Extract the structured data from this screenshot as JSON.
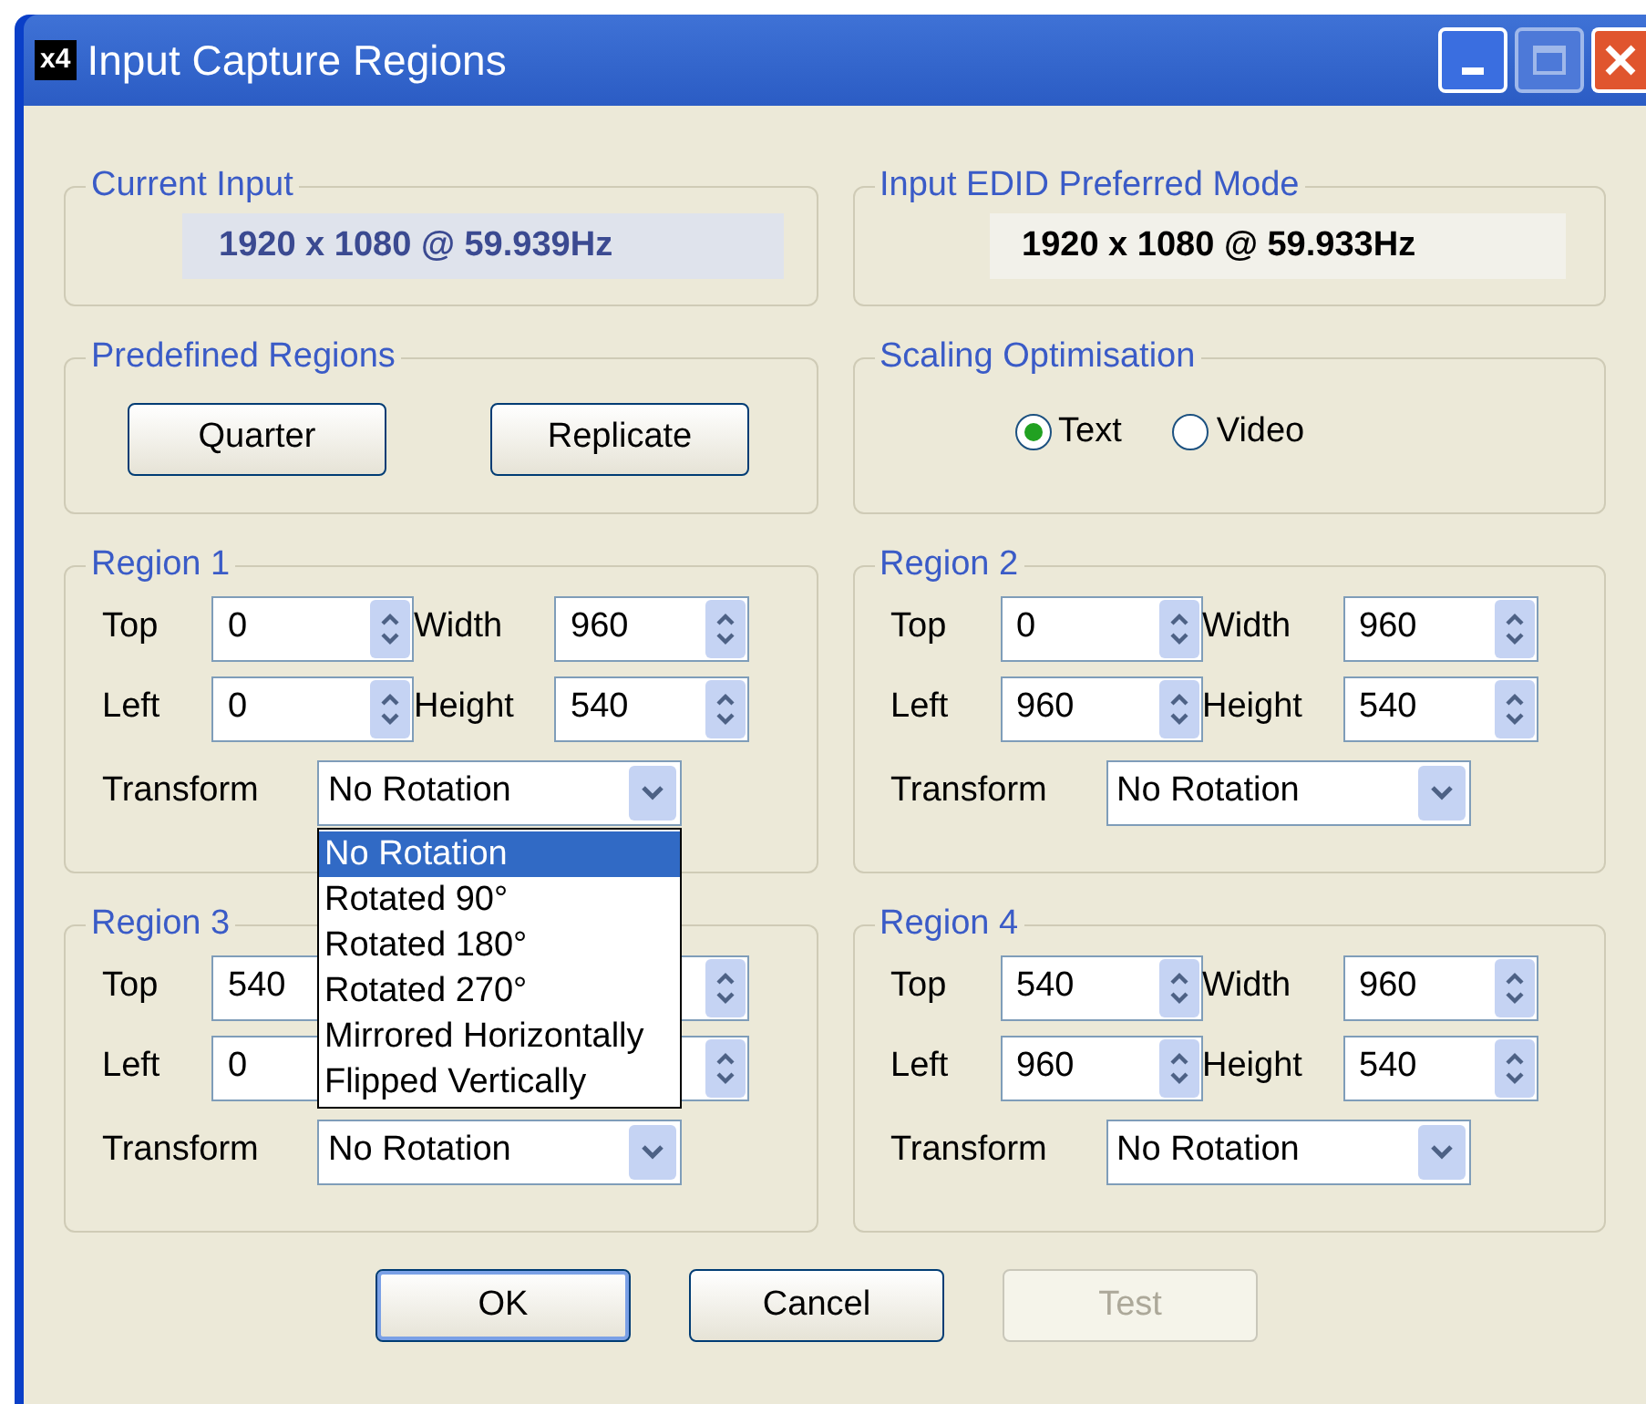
{
  "window": {
    "title": "Input Capture Regions",
    "logo": "x4"
  },
  "current_input": {
    "title": "Current Input",
    "value": "1920 x 1080 @ 59.939Hz"
  },
  "edid": {
    "title": "Input EDID Preferred Mode",
    "value": "1920 x 1080 @ 59.933Hz"
  },
  "predefined": {
    "title": "Predefined Regions",
    "buttons": [
      "Quarter",
      "Replicate"
    ]
  },
  "scaling": {
    "title": "Scaling Optimisation",
    "options": [
      {
        "label": "Text",
        "selected": true
      },
      {
        "label": "Video",
        "selected": false
      }
    ]
  },
  "regions": [
    {
      "title": "Region 1",
      "fields": {
        "top": {
          "label": "Top",
          "value": "0"
        },
        "width": {
          "label": "Width",
          "value": "960"
        },
        "left": {
          "label": "Left",
          "value": "0"
        },
        "height": {
          "label": "Height",
          "value": "540"
        }
      },
      "transform_label": "Transform",
      "transform": "No Rotation",
      "dropdown": {
        "options": [
          {
            "label": "No Rotation",
            "selected": true
          },
          {
            "label": "Rotated 90°",
            "selected": false
          },
          {
            "label": "Rotated 180°",
            "selected": false
          },
          {
            "label": "Rotated 270°",
            "selected": false
          },
          {
            "label": "Mirrored Horizontally",
            "selected": false
          },
          {
            "label": "Flipped Vertically",
            "selected": false
          }
        ]
      }
    },
    {
      "title": "Region 2",
      "fields": {
        "top": {
          "label": "Top",
          "value": "0"
        },
        "width": {
          "label": "Width",
          "value": "960"
        },
        "left": {
          "label": "Left",
          "value": "960"
        },
        "height": {
          "label": "Height",
          "value": "540"
        }
      },
      "transform_label": "Transform",
      "transform": "No Rotation"
    },
    {
      "title": "Region 3",
      "fields": {
        "top": {
          "label": "Top",
          "value": "540"
        },
        "left": {
          "label": "Left",
          "value": "0"
        }
      },
      "transform_label": "Transform",
      "transform": "No Rotation"
    },
    {
      "title": "Region 4",
      "fields": {
        "top": {
          "label": "Top",
          "value": "540"
        },
        "width": {
          "label": "Width",
          "value": "960"
        },
        "left": {
          "label": "Left",
          "value": "960"
        },
        "height": {
          "label": "Height",
          "value": "540"
        }
      },
      "transform_label": "Transform",
      "transform": "No Rotation"
    }
  ],
  "buttons": [
    {
      "label": "OK",
      "default": true,
      "disabled": false
    },
    {
      "label": "Cancel",
      "default": false,
      "disabled": false
    },
    {
      "label": "Test",
      "default": false,
      "disabled": true
    }
  ]
}
